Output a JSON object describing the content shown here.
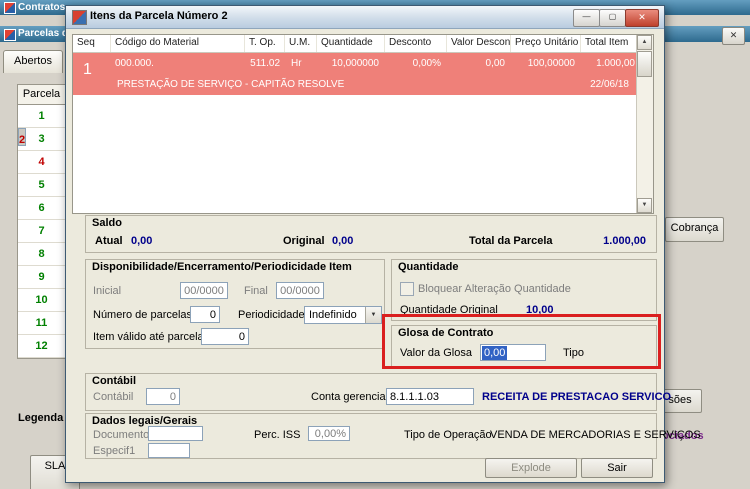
{
  "colors": {
    "titlebar_teal": "#2e6a8e",
    "selected_row_bg": "#ef8079",
    "value_navy": "#00008b",
    "annotation_red": "#da1f1f",
    "parcela_green": "#008000",
    "parcela_red": "#c00000",
    "link_purple": "#7b2d8b",
    "selection_blue": "#3162c4"
  },
  "icons": {
    "close": "✕",
    "minimize": "—",
    "maximize": "▢",
    "dropdown_arrow": "▼",
    "scroll_up": "▲",
    "scroll_down": "▼"
  },
  "background": {
    "app_title": "Contratos",
    "panel_title": "Parcelas di",
    "abertos_tab": "Abertos",
    "parcela_header": "Parcela",
    "parcelas": [
      {
        "num": "1",
        "color": "#008000"
      },
      {
        "num": "2",
        "color": "#c00000"
      },
      {
        "num": "3",
        "color": "#008000"
      },
      {
        "num": "4",
        "color": "#c00000"
      },
      {
        "num": "5",
        "color": "#008000"
      },
      {
        "num": "6",
        "color": "#008000"
      },
      {
        "num": "7",
        "color": "#008000"
      },
      {
        "num": "8",
        "color": "#008000"
      },
      {
        "num": "9",
        "color": "#008000"
      },
      {
        "num": "10",
        "color": "#008000"
      },
      {
        "num": "11",
        "color": "#008000"
      },
      {
        "num": "12",
        "color": "#008000"
      }
    ],
    "legenda_label": "Legenda",
    "sla_button": "SLA",
    "cobranca_button": "Cobrança",
    "impressoes_button_partial": "sões",
    "associados_link_partial": "ociados"
  },
  "dialog": {
    "title": "Itens da Parcela Número 2",
    "grid": {
      "headers": [
        "Seq",
        "Código do Material",
        "T. Op.",
        "U.M.",
        "Quantidade",
        "Desconto",
        "Valor Desconto",
        "Preço Unitário",
        "Total Item"
      ],
      "row": {
        "seq": "1",
        "codigo_material": "000.000.",
        "t_op": "511.02",
        "um": "Hr",
        "quantidade": "10,000000",
        "desconto": "0,00%",
        "valor_desconto": "0,00",
        "preco_unitario": "100,00000",
        "total_item": "1.000,00",
        "descricao": "PRESTAÇÃO DE SERVIÇO - CAPITÃO RESOLVE",
        "data": "22/06/18"
      }
    },
    "saldo": {
      "title": "Saldo",
      "atual_label": "Atual",
      "atual_value": "0,00",
      "original_label": "Original",
      "original_value": "0,00",
      "total_parcela_label": "Total da Parcela",
      "total_parcela_value": "1.000,00"
    },
    "disponibilidade": {
      "title": "Disponibilidade/Encerramento/Periodicidade Item",
      "inicial_label": "Inicial",
      "inicial_value": "00/0000",
      "final_label": "Final",
      "final_value": "00/0000",
      "numero_parcelas_label": "Número de parcelas",
      "numero_parcelas_value": "0",
      "periodicidade_label": "Periodicidade",
      "periodicidade_value": "Indefinido",
      "item_valido_label": "Item válido até parcela",
      "item_valido_value": "0"
    },
    "quantidade": {
      "title": "Quantidade",
      "bloquear_label": "Bloquear Alteração Quantidade",
      "quantidade_original_label": "Quantidade Original",
      "quantidade_original_value": "10,00"
    },
    "glosa": {
      "title": "Glosa de Contrato",
      "valor_label": "Valor da Glosa",
      "valor_value": "0,00",
      "tipo_label": "Tipo"
    },
    "contabil": {
      "title": "Contábil",
      "contabil_label": "Contábil",
      "contabil_value": "0",
      "conta_gerencial_label": "Conta gerencial",
      "conta_gerencial_value": "8.1.1.1.03",
      "conta_gerencial_desc": "RECEITA DE PRESTACAO SERVICO"
    },
    "dados_legais": {
      "title": "Dados legais/Gerais",
      "documento_label": "Documento",
      "documento_value": "",
      "perc_iss_label": "Perc. ISS",
      "perc_iss_value": "0,00%",
      "tipo_operacao_label": "Tipo de Operação",
      "tipo_operacao_value": "VENDA DE MERCADORIAS E SERVIÇOS",
      "especif1_label": "Especif1",
      "especif1_value": ""
    },
    "buttons": {
      "explode": "Explode",
      "sair": "Sair"
    }
  }
}
